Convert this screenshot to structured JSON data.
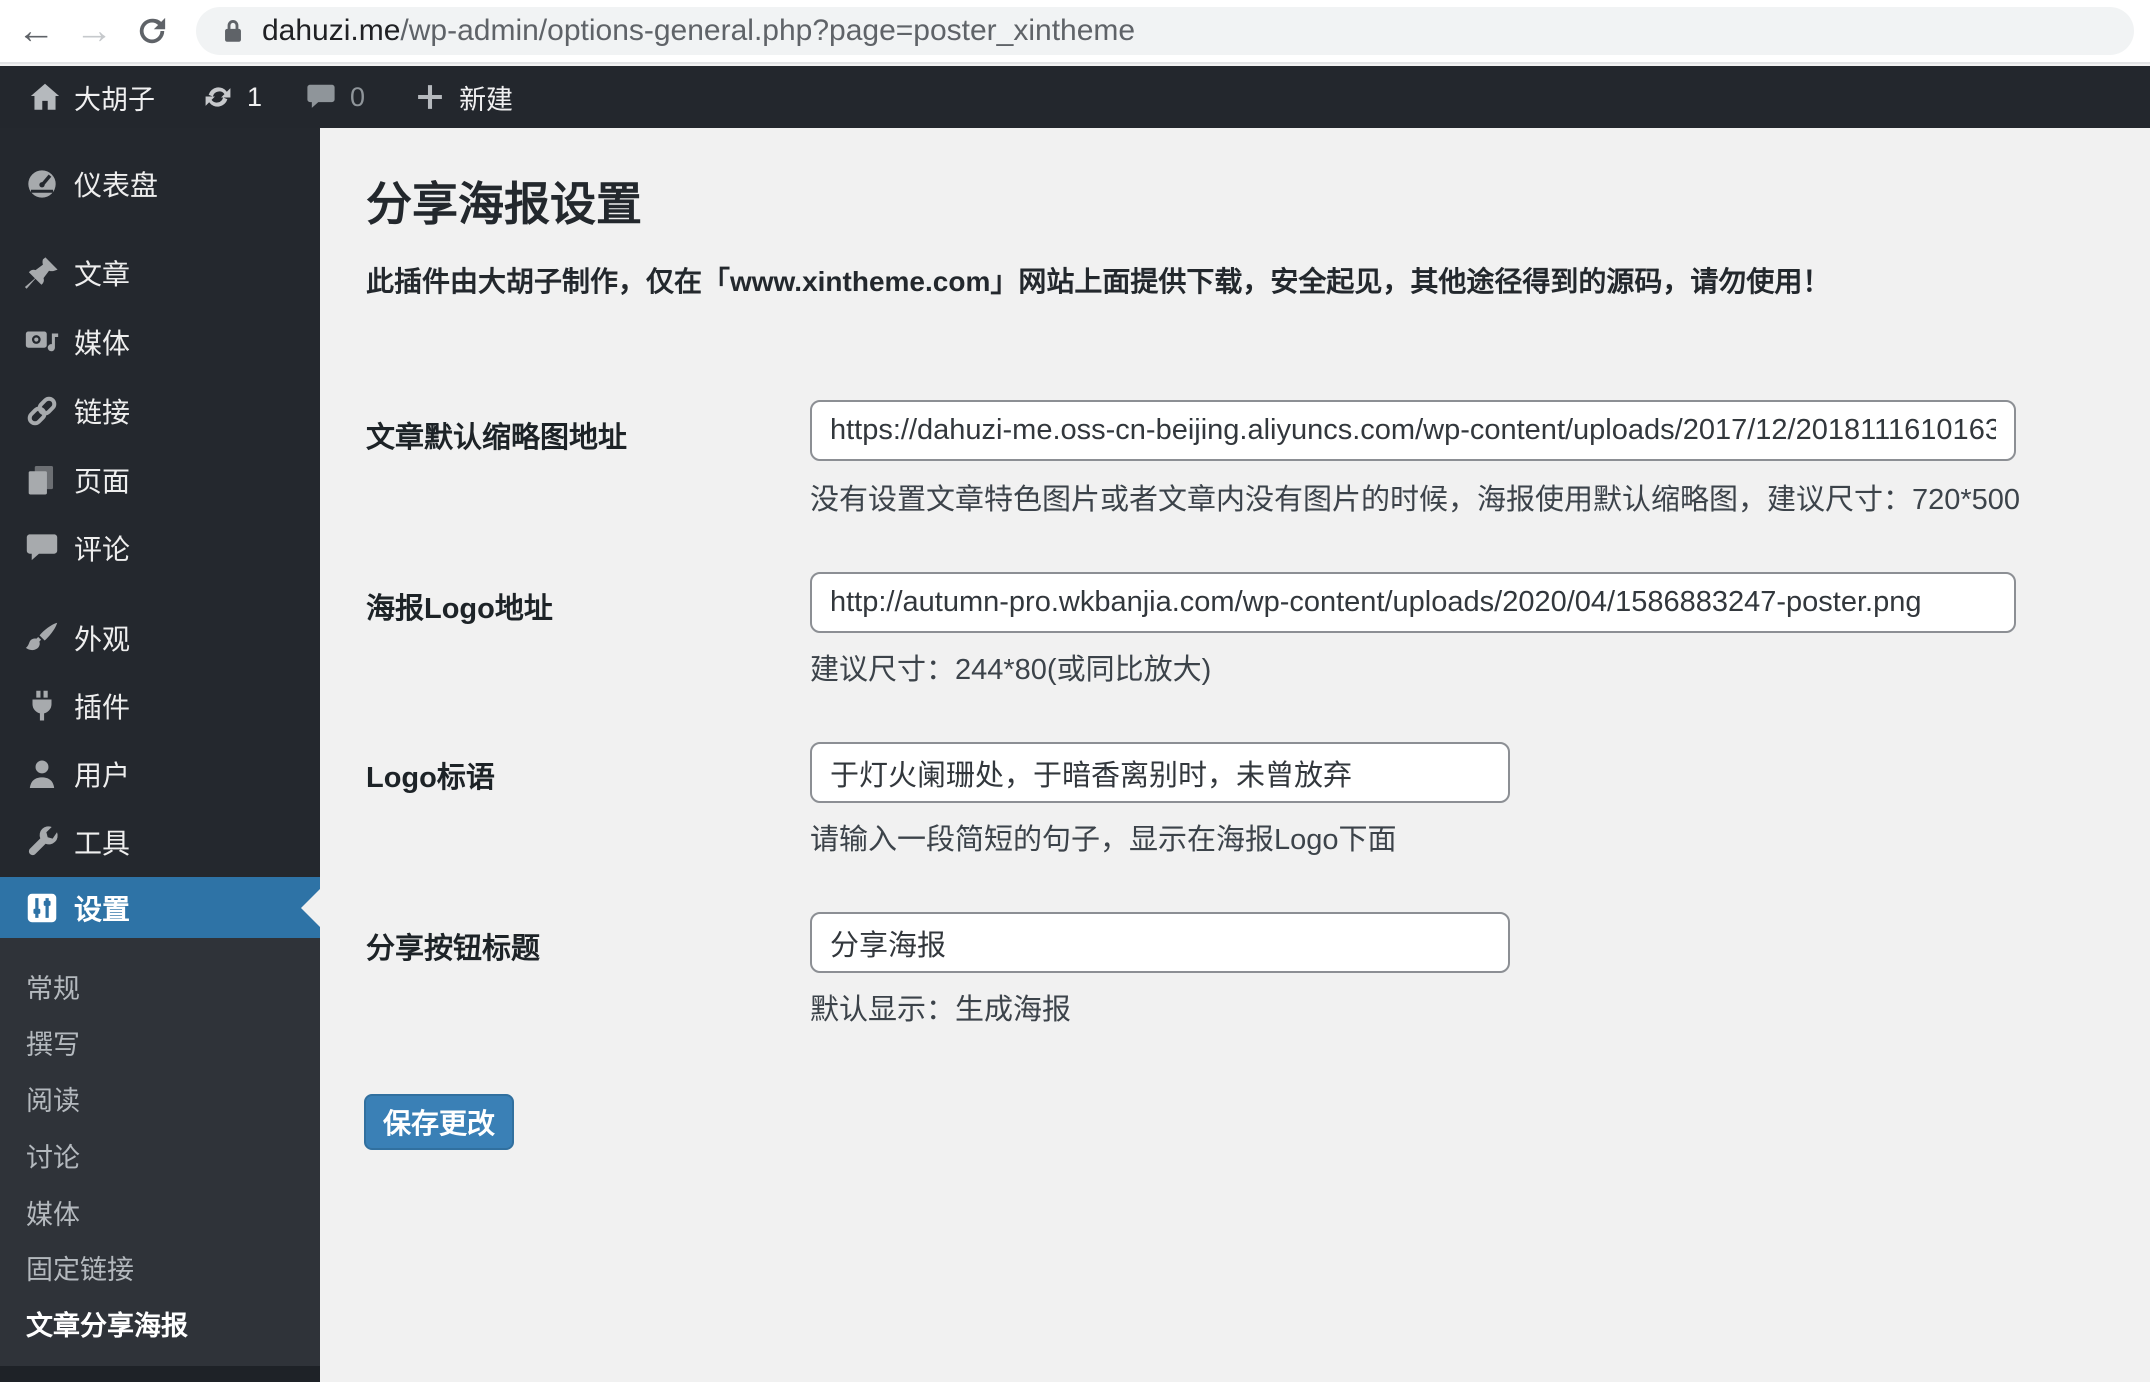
{
  "colors": {
    "admin_bar_bg": "#23272d",
    "sidebar_bg": "#24282e",
    "submenu_bg": "#2f3339",
    "active_menu_blue": "#2e73a6",
    "button_blue": "#3a80b6",
    "content_bg": "#f1f1f1"
  },
  "browser": {
    "url": "dahuzi.me/wp-admin/options-general.php?page=poster_xintheme",
    "url_domain": "dahuzi.me",
    "url_path": "/wp-admin/options-general.php?page=poster_xintheme",
    "icons": [
      "back-icon",
      "forward-icon",
      "refresh-icon",
      "lock-icon"
    ]
  },
  "admin_bar": {
    "home_icon": "home-icon",
    "site_name": "大胡子",
    "updates_icon": "updates-icon",
    "update_count": "1",
    "comments_icon": "comment-icon",
    "comment_count": "0",
    "plus_icon": "plus-icon",
    "new_label": "新建"
  },
  "sidebar": {
    "items": [
      {
        "label": "仪表盘",
        "icon": "dashboard-icon"
      },
      {
        "label": "文章",
        "icon": "pin-icon"
      },
      {
        "label": "媒体",
        "icon": "media-icon"
      },
      {
        "label": "链接",
        "icon": "link-icon"
      },
      {
        "label": "页面",
        "icon": "pages-icon"
      },
      {
        "label": "评论",
        "icon": "comment-icon"
      },
      {
        "label": "外观",
        "icon": "brush-icon"
      },
      {
        "label": "插件",
        "icon": "plugin-icon"
      },
      {
        "label": "用户",
        "icon": "user-icon"
      },
      {
        "label": "工具",
        "icon": "wrench-icon"
      },
      {
        "label": "设置",
        "icon": "settings-sliders-icon"
      }
    ],
    "submenu": [
      {
        "label": "常规"
      },
      {
        "label": "撰写"
      },
      {
        "label": "阅读"
      },
      {
        "label": "讨论"
      },
      {
        "label": "媒体"
      },
      {
        "label": "固定链接"
      },
      {
        "label": "文章分享海报"
      }
    ]
  },
  "main": {
    "title": "分享海报设置",
    "notice": "此插件由大胡子制作，仅在「www.xintheme.com」网站上面提供下载，安全起见，其他途径得到的源码，请勿使用！",
    "fields": [
      {
        "label": "文章默认缩略图地址",
        "value": "https://dahuzi-me.oss-cn-beijing.aliyuncs.com/wp-content/uploads/2017/12/2018111610163",
        "help": "没有设置文章特色图片或者文章内没有图片的时候，海报使用默认缩略图，建议尺寸：720*500"
      },
      {
        "label": "海报Logo地址",
        "value": "http://autumn-pro.wkbanjia.com/wp-content/uploads/2020/04/1586883247-poster.png",
        "help": "建议尺寸：244*80(或同比放大)"
      },
      {
        "label": "Logo标语",
        "value": "于灯火阑珊处，于暗香离别时，未曾放弃",
        "help": "请输入一段简短的句子，显示在海报Logo下面"
      },
      {
        "label": "分享按钮标题",
        "value": "分享海报",
        "help": "默认显示：生成海报"
      }
    ],
    "save_label": "保存更改"
  }
}
